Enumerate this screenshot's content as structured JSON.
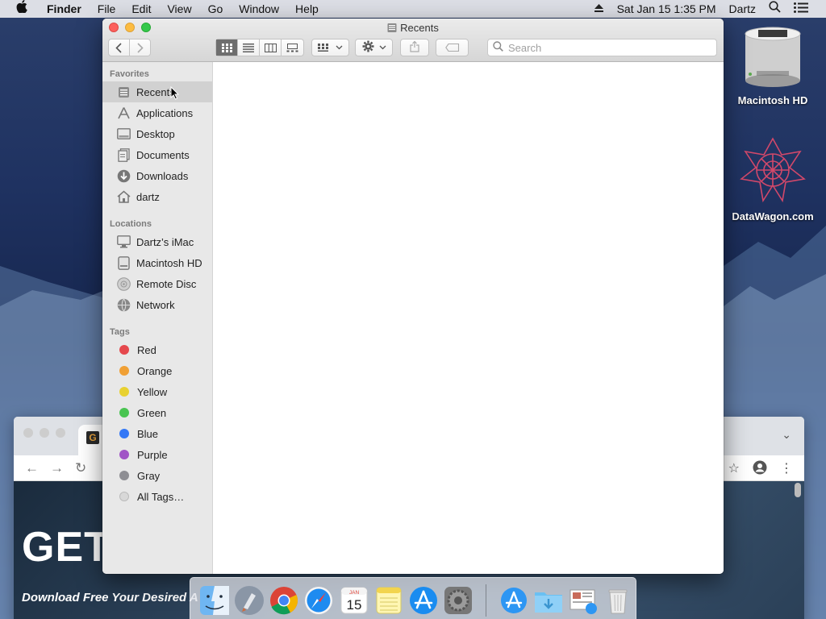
{
  "menubar": {
    "apple_icon": "apple-icon",
    "app_name": "Finder",
    "items": [
      "File",
      "Edit",
      "View",
      "Go",
      "Window",
      "Help"
    ],
    "datetime": "Sat Jan 15  1:35 PM",
    "user": "Dartz"
  },
  "desktop": {
    "icons": [
      {
        "label": "Macintosh HD"
      },
      {
        "label": "DataWagon.com"
      }
    ]
  },
  "finder": {
    "title": "Recents",
    "search_placeholder": "Search",
    "sidebar": {
      "favorites_header": "Favorites",
      "favorites": [
        {
          "label": "Recents",
          "icon": "recents-icon",
          "selected": true
        },
        {
          "label": "Applications",
          "icon": "applications-icon"
        },
        {
          "label": "Desktop",
          "icon": "desktop-icon"
        },
        {
          "label": "Documents",
          "icon": "documents-icon"
        },
        {
          "label": "Downloads",
          "icon": "downloads-icon"
        },
        {
          "label": "dartz",
          "icon": "home-icon"
        }
      ],
      "locations_header": "Locations",
      "locations": [
        {
          "label": "Dartz’s iMac",
          "icon": "imac-icon"
        },
        {
          "label": "Macintosh HD",
          "icon": "disk-icon"
        },
        {
          "label": "Remote Disc",
          "icon": "disc-icon"
        },
        {
          "label": "Network",
          "icon": "network-icon"
        }
      ],
      "tags_header": "Tags",
      "tags": [
        {
          "label": "Red",
          "color": "#e5484d"
        },
        {
          "label": "Orange",
          "color": "#f0a035"
        },
        {
          "label": "Yellow",
          "color": "#e8d131"
        },
        {
          "label": "Green",
          "color": "#49c451"
        },
        {
          "label": "Blue",
          "color": "#3478f6"
        },
        {
          "label": "Purple",
          "color": "#a154c6"
        },
        {
          "label": "Gray",
          "color": "#8e8e93"
        },
        {
          "label": "All Tags…",
          "color": "#d8d8d8"
        }
      ]
    }
  },
  "browser": {
    "favicon_letter": "G",
    "headline": "GET",
    "subline": "Download Free Your Desired A"
  },
  "dock": {
    "apps": [
      "finder",
      "launchpad",
      "chrome",
      "safari",
      "calendar",
      "notes",
      "app-store",
      "system-preferences",
      "app-store-folder",
      "downloads-folder",
      "preview",
      "trash"
    ],
    "calendar_month": "JAN",
    "calendar_day": "15"
  }
}
